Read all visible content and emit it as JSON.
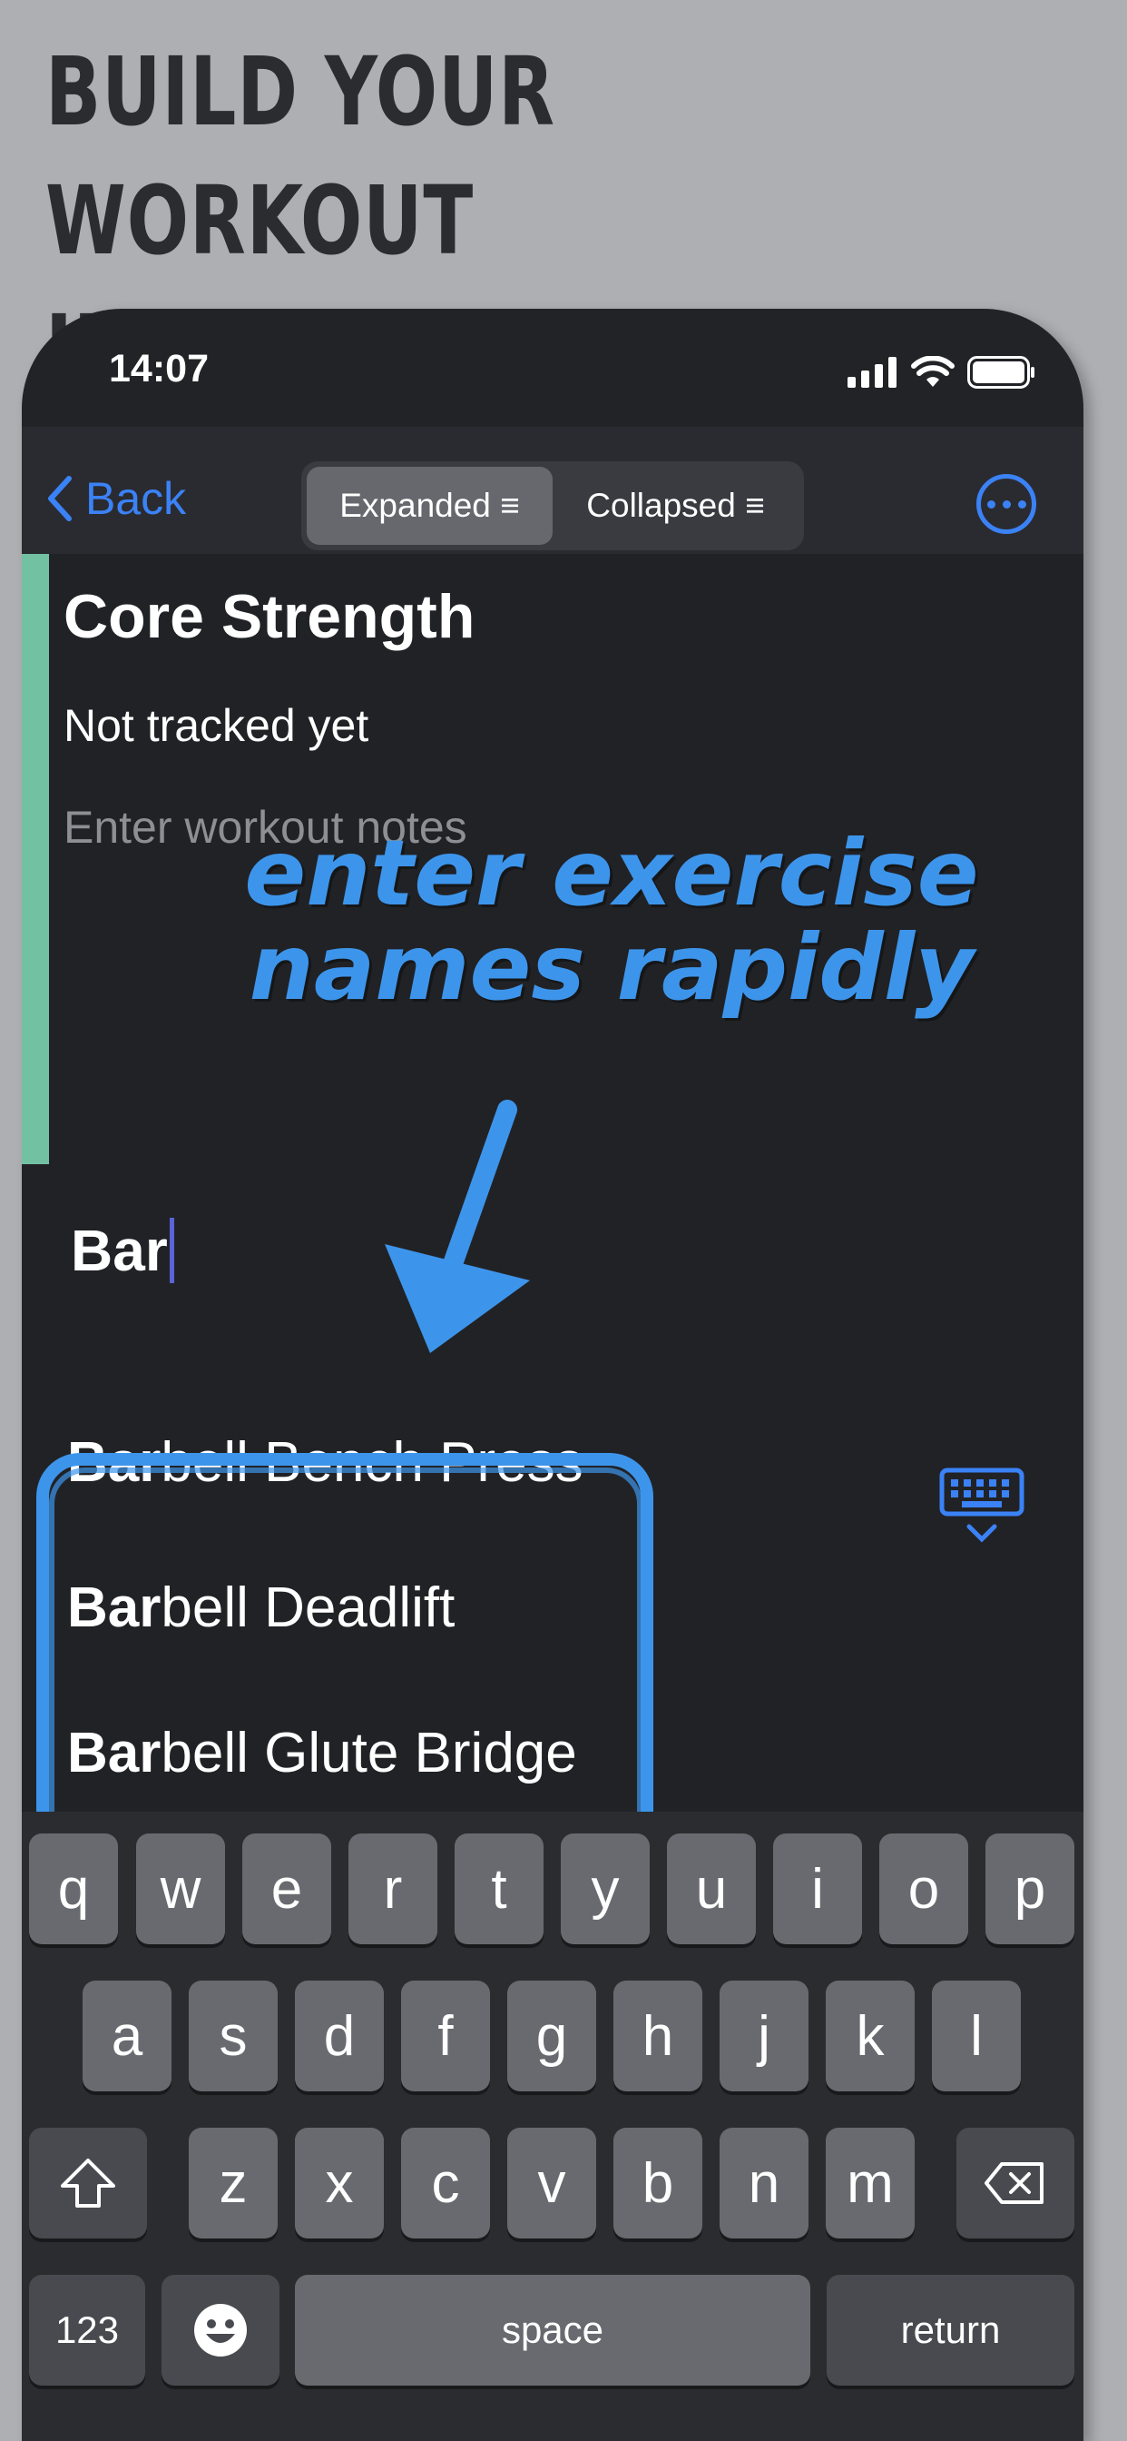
{
  "headline": {
    "line1": "BUILD YOUR WORKOUT",
    "line2": "IN SECONDS"
  },
  "status": {
    "time": "14:07"
  },
  "nav": {
    "back_label": "Back",
    "segments": [
      {
        "label": "Expanded ≡",
        "selected": true
      },
      {
        "label": "Collapsed ≡",
        "selected": false
      }
    ],
    "more_icon": "ellipsis-circle-icon"
  },
  "workout": {
    "title": "Core Strength",
    "tracking_status": "Not tracked yet",
    "notes_placeholder": "Enter workout notes",
    "accent_color": "#72c1a3"
  },
  "annotation": {
    "line1": "enter exercise",
    "line2": "names rapidly",
    "color": "#3d95eb"
  },
  "exercise_input": {
    "value": "Bar"
  },
  "suggestions": [
    {
      "match": "Bar",
      "rest": "bell Bench Press"
    },
    {
      "match": "Bar",
      "rest": "bell Deadlift"
    },
    {
      "match": "Bar",
      "rest": "bell Glute Bridge"
    }
  ],
  "keyboard": {
    "row1": [
      "q",
      "w",
      "e",
      "r",
      "t",
      "y",
      "u",
      "i",
      "o",
      "p"
    ],
    "row2": [
      "a",
      "s",
      "d",
      "f",
      "g",
      "h",
      "j",
      "k",
      "l"
    ],
    "row3": [
      "z",
      "x",
      "c",
      "v",
      "b",
      "n",
      "m"
    ],
    "numbers_label": "123",
    "space_label": "space",
    "return_label": "return"
  }
}
